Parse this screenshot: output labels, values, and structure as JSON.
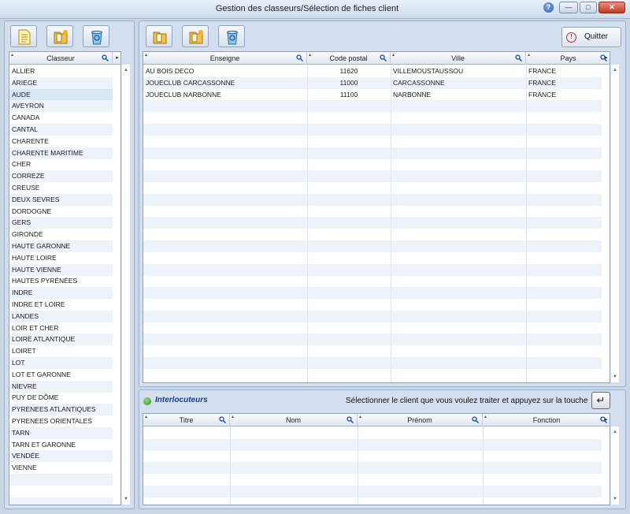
{
  "window": {
    "title": "Gestion des classeurs/Sélection de fiches client",
    "help": "?",
    "minimize": "—",
    "maximize": "□",
    "close": "✕"
  },
  "left": {
    "toolbar": [
      "new-document-icon",
      "new-folder-icon",
      "recycle-bin-icon"
    ],
    "header": "Classeur",
    "items": [
      "ALLIER",
      "ARIEGE",
      "AUDE",
      "AVEYRON",
      "CANADA",
      "CANTAL",
      "CHARENTE",
      "CHARENTE MARITIME",
      "CHER",
      "CORREZE",
      "CREUSE",
      "DEUX SEVRES",
      "DORDOGNE",
      "GERS",
      "GIRONDE",
      "HAUTE GARONNE",
      "HAUTE LOIRE",
      "HAUTE VIENNE",
      "HAUTES PYRÉNÉES",
      "INDRE",
      "INDRE ET LOIRE",
      "LANDES",
      "LOIR ET CHER",
      "LOIRE ATLANTIQUE",
      "LOIRET",
      "LOT",
      "LOT ET GARONNE",
      "NIEVRE",
      "PUY DE DÔME",
      "PYRENEES ATLANTIQUES",
      "PYRENEES ORIENTALES",
      "TARN",
      "TARN ET GARONNE",
      "VENDÉE",
      "VIENNE"
    ],
    "selected_index": 2
  },
  "clients": {
    "toolbar": [
      "new-folder-icon",
      "new-folder-icon",
      "recycle-bin-icon"
    ],
    "quit_label": "Quitter",
    "columns": [
      "Enseigne",
      "Code postal",
      "Ville",
      "Pays"
    ],
    "rows": [
      [
        "AU BOIS DECO",
        "11620",
        "VILLEMOUSTAUSSOU",
        "FRANCE"
      ],
      [
        "JOUECLUB CARCASSONNE",
        "11000",
        "CARCASSONNE",
        "FRANCE"
      ],
      [
        "JOUECLUB NARBONNE",
        "11100",
        "NARBONNE",
        "FRANCE"
      ]
    ]
  },
  "contacts": {
    "title": "Interlocuteurs",
    "hint": "Sélectionner le client que vous voulez traiter et appuyez sur la touche",
    "enter_key": "↵",
    "columns": [
      "Titre",
      "Nom",
      "Prénom",
      "Fonction"
    ]
  },
  "colors": {
    "accent": "#173f8a",
    "selection": "#d9e6f5",
    "row_alt": "#edf3fa"
  }
}
